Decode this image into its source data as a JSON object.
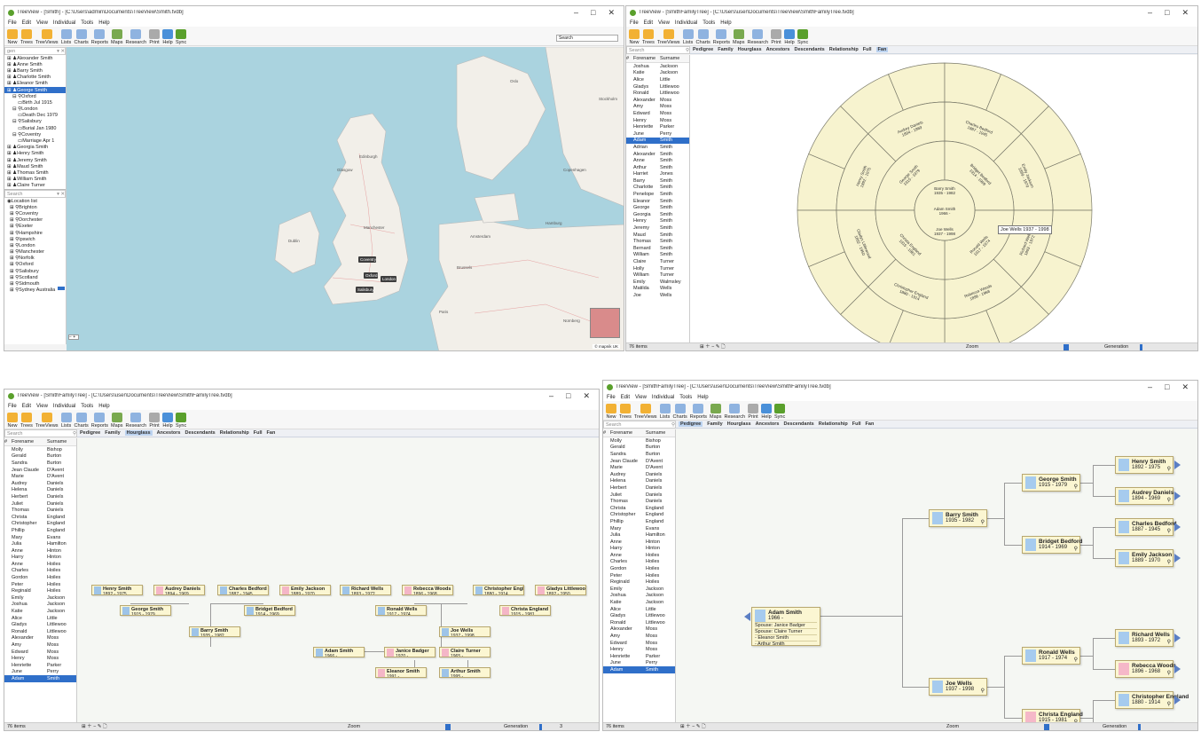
{
  "common": {
    "menu": [
      "File",
      "Edit",
      "View",
      "Individual",
      "Tools",
      "Help"
    ],
    "toolbar": [
      "New",
      "Trees",
      "TreeViews",
      "Lists",
      "Charts",
      "Reports",
      "Maps",
      "Research",
      "Print",
      "Help",
      "Sync"
    ],
    "views": [
      "Pedigree",
      "Family",
      "Hourglass",
      "Ancestors",
      "Descendants",
      "Relationship",
      "Full",
      "Fan"
    ],
    "search": "Search",
    "status_items": "76 items",
    "zoom": "Zoom",
    "generation": "Generation",
    "col_hash": "#",
    "col_forename": "Forename",
    "col_surname": "Surname"
  },
  "win_map": {
    "title": "TreeView - [Smith] - [C:\\Users\\admin\\Documents\\TreeView\\Smith.tvdb]",
    "toolbar": [
      "New",
      "Trees",
      "TreeViews",
      "Lists",
      "Charts",
      "Reports",
      "Maps",
      "Research",
      "Print",
      "Help",
      "Sync"
    ],
    "tree_rows": [
      "Alexander Smith",
      "Anne Smith",
      "Barry Smith",
      "Charlotte Smith",
      "Eleanor Smith",
      "George Smith",
      "Oxford",
      "Birth Jul 1915",
      "London",
      "Death Dec 1979",
      "Salisbury",
      "Burial Jan 1980",
      "Coventry",
      "Marriage Apr 1",
      "Georgia Smith",
      "Henry Smith",
      "Jeremy Smith",
      "Maud Smith",
      "Thomas Smith",
      "William Smith",
      "Claire Turner"
    ],
    "selected_tree": "George Smith",
    "loc_search": "Search",
    "location_title": "Location list",
    "locations": [
      "Brighton",
      "Coventry",
      "Dorchester",
      "Exeter",
      "Hampshire",
      "Ipswich",
      "London",
      "Manchester",
      "Norfolk",
      "Oxford",
      "Salisbury",
      "Scotland",
      "Sidmouth",
      "Sydney Australia"
    ],
    "map_labels": [
      "Coventry",
      "Oxford",
      "London",
      "Salisbury",
      "Edinburgh",
      "Glasgow",
      "Manchester",
      "Dublin",
      "Amsterdam",
      "Brussels",
      "Paris",
      "Hamburg",
      "Copenhagen",
      "Oslo",
      "Stockholm",
      "Nürnberg"
    ],
    "map_search": "Search",
    "provider": "© mapnik  UK"
  },
  "win_fan": {
    "title": "TreeView - [SmithFamilyTree] - [C:\\Users\\user\\Documents\\TreeView\\SmithFamilyTree.tvdb]",
    "active_view": "Fan",
    "rows": [
      [
        "Joshua",
        "Jackson"
      ],
      [
        "Katie",
        "Jackson"
      ],
      [
        "Alice",
        "Little"
      ],
      [
        "Gladys",
        "Littlewoo"
      ],
      [
        "Ronald",
        "Littlewoo"
      ],
      [
        "Alexander",
        "Moss"
      ],
      [
        "Amy",
        "Moss"
      ],
      [
        "Edward",
        "Moss"
      ],
      [
        "Henry",
        "Moss"
      ],
      [
        "Henriette",
        "Parker"
      ],
      [
        "June",
        "Perry"
      ],
      [
        "Adam",
        "Smith"
      ],
      [
        "Adrian",
        "Smith"
      ],
      [
        "Alexander",
        "Smith"
      ],
      [
        "Anne",
        "Smith"
      ],
      [
        "Arthur",
        "Smith"
      ],
      [
        "Harriet",
        "Jones"
      ],
      [
        "Barry",
        "Smith"
      ],
      [
        "Charlotte",
        "Smith"
      ],
      [
        "Penelope",
        "Smith"
      ],
      [
        "Eleanor",
        "Smith"
      ],
      [
        "George",
        "Smith"
      ],
      [
        "Georgia",
        "Smith"
      ],
      [
        "Henry",
        "Smith"
      ],
      [
        "Jeremy",
        "Smith"
      ],
      [
        "Maud",
        "Smith"
      ],
      [
        "Thomas",
        "Smith"
      ],
      [
        "Bernard",
        "Smith"
      ],
      [
        "William",
        "Smith"
      ],
      [
        "Claire",
        "Turner"
      ],
      [
        "Holly",
        "Turner"
      ],
      [
        "William",
        "Turner"
      ],
      [
        "Emily",
        "Walmsley"
      ],
      [
        "Matilda",
        "Wells"
      ],
      [
        "Joe",
        "Wells"
      ]
    ],
    "selected_row": 11,
    "center": "Adam Smith\n1966 -",
    "ring1": [
      "Barry Smith\n1935 - 1982",
      "Joe Wells\n1937 - 1998"
    ],
    "ring2": [
      "George Smith\n1915 - 1979",
      "Bridget Bedford\n1914 - 1969",
      "Ronald Wells\n1917 - 1974",
      "Christa England\n1915 - 1981"
    ],
    "ring3": [
      "Henry Smith\n1892 - 1975",
      "Audrey Daniels\n1894 - 1969",
      "Charles Bedford\n1887 - 1945",
      "Emily Jackson\n1889 - 1970",
      "Richard Wells\n1893 - 1972",
      "Rebecca Woods\n1896 - 1968",
      "Christopher England\n1880 - 1914",
      "Gladys Littlewood\n1892 - 1950"
    ],
    "tooltip": "Joe Wells 1937 - 1998"
  },
  "win_hour": {
    "title": "TreeView - [SmithFamilyTree] - [C:\\Users\\user\\Documents\\TreeView\\SmithFamilyTree.tvdb]",
    "active_view": "Hourglass",
    "rows": [
      [
        "Molly",
        "Bishop"
      ],
      [
        "Gerald",
        "Burton"
      ],
      [
        "Sandra",
        "Burton"
      ],
      [
        "Jean Claude",
        "D'Avent"
      ],
      [
        "Marie",
        "D'Avent"
      ],
      [
        "Audrey",
        "Daniels"
      ],
      [
        "Helena",
        "Daniels"
      ],
      [
        "Herbert",
        "Daniels"
      ],
      [
        "Juliet",
        "Daniels"
      ],
      [
        "Thomas",
        "Daniels"
      ],
      [
        "Christa",
        "England"
      ],
      [
        "Christopher",
        "England"
      ],
      [
        "Phillip",
        "England"
      ],
      [
        "Mary",
        "Evans"
      ],
      [
        "Julia",
        "Hamilton"
      ],
      [
        "Anne",
        "Hinton"
      ],
      [
        "Harry",
        "Hinton"
      ],
      [
        "Anne",
        "Hoiles"
      ],
      [
        "Charles",
        "Hoiles"
      ],
      [
        "Gordon",
        "Hoiles"
      ],
      [
        "Peter",
        "Hoiles"
      ],
      [
        "Reginald",
        "Hoiles"
      ],
      [
        "Emily",
        "Jackson"
      ],
      [
        "Joshua",
        "Jackson"
      ],
      [
        "Katie",
        "Jackson"
      ],
      [
        "Alice",
        "Little"
      ],
      [
        "Gladys",
        "Littlewoo"
      ],
      [
        "Ronald",
        "Littlewoo"
      ],
      [
        "Alexander",
        "Moss"
      ],
      [
        "Amy",
        "Moss"
      ],
      [
        "Edward",
        "Moss"
      ],
      [
        "Henry",
        "Moss"
      ],
      [
        "Henriette",
        "Parker"
      ],
      [
        "June",
        "Perry"
      ],
      [
        "Adam",
        "Smith"
      ]
    ],
    "selected_row": 34,
    "status_right": "3"
  },
  "win_ped": {
    "title": "TreeView - [SmithFamilyTree] - [C:\\Users\\user\\Documents\\TreeView\\SmithFamilyTree.tvdb]",
    "active_view": "Pedigree",
    "rows": [
      [
        "Molly",
        "Bishop"
      ],
      [
        "Gerald",
        "Burton"
      ],
      [
        "Sandra",
        "Burton"
      ],
      [
        "Jean Claude",
        "D'Avent"
      ],
      [
        "Marie",
        "D'Avent"
      ],
      [
        "Audrey",
        "Daniels"
      ],
      [
        "Helena",
        "Daniels"
      ],
      [
        "Herbert",
        "Daniels"
      ],
      [
        "Juliet",
        "Daniels"
      ],
      [
        "Thomas",
        "Daniels"
      ],
      [
        "Christa",
        "England"
      ],
      [
        "Christopher",
        "England"
      ],
      [
        "Phillip",
        "England"
      ],
      [
        "Mary",
        "Evans"
      ],
      [
        "Julia",
        "Hamilton"
      ],
      [
        "Anne",
        "Hinton"
      ],
      [
        "Harry",
        "Hinton"
      ],
      [
        "Anne",
        "Hoiles"
      ],
      [
        "Charles",
        "Hoiles"
      ],
      [
        "Gordon",
        "Hoiles"
      ],
      [
        "Peter",
        "Hoiles"
      ],
      [
        "Reginald",
        "Hoiles"
      ],
      [
        "Emily",
        "Jackson"
      ],
      [
        "Joshua",
        "Jackson"
      ],
      [
        "Katie",
        "Jackson"
      ],
      [
        "Alice",
        "Little"
      ],
      [
        "Gladys",
        "Littlewoo"
      ],
      [
        "Ronald",
        "Littlewoo"
      ],
      [
        "Alexander",
        "Moss"
      ],
      [
        "Amy",
        "Moss"
      ],
      [
        "Edward",
        "Moss"
      ],
      [
        "Henry",
        "Moss"
      ],
      [
        "Henriette",
        "Parker"
      ],
      [
        "June",
        "Perry"
      ],
      [
        "Adam",
        "Smith"
      ]
    ],
    "selected_row": 34,
    "root": {
      "name": "Adam Smith",
      "dates": "1966 -",
      "spouse1": "Spouse: Janice Badger",
      "spouse2": "Spouse: Claire Turner",
      "child1": "- Eleanor Smith",
      "child2": "- Arthur Smith"
    },
    "people": [
      {
        "name": "Barry Smith",
        "dates": "1935 - 1982"
      },
      {
        "name": "Joe Wells",
        "dates": "1937 - 1998"
      },
      {
        "name": "George Smith",
        "dates": "1915 - 1979"
      },
      {
        "name": "Bridget Bedford",
        "dates": "1914 - 1969"
      },
      {
        "name": "Ronald Wells",
        "dates": "1917 - 1974"
      },
      {
        "name": "Christa England",
        "dates": "1915 - 1981"
      },
      {
        "name": "Henry Smith",
        "dates": "1892 - 1975"
      },
      {
        "name": "Audrey Daniels",
        "dates": "1894 - 1969"
      },
      {
        "name": "Charles Bedford",
        "dates": "1887 - 1945"
      },
      {
        "name": "Emily Jackson",
        "dates": "1889 - 1970"
      },
      {
        "name": "Richard Wells",
        "dates": "1893 - 1972"
      },
      {
        "name": "Rebecca Woods",
        "dates": "1896 - 1968"
      },
      {
        "name": "Christopher England",
        "dates": "1880 - 1914"
      },
      {
        "name": "Gladys Littlewood",
        "dates": "1892 - 1950"
      }
    ]
  },
  "colors": {
    "accent": "#2f6fc9",
    "card": "#fbf6d2",
    "fan": "#f7f3cf",
    "map_sea": "#aad3df",
    "map_land": "#f2efe9"
  }
}
